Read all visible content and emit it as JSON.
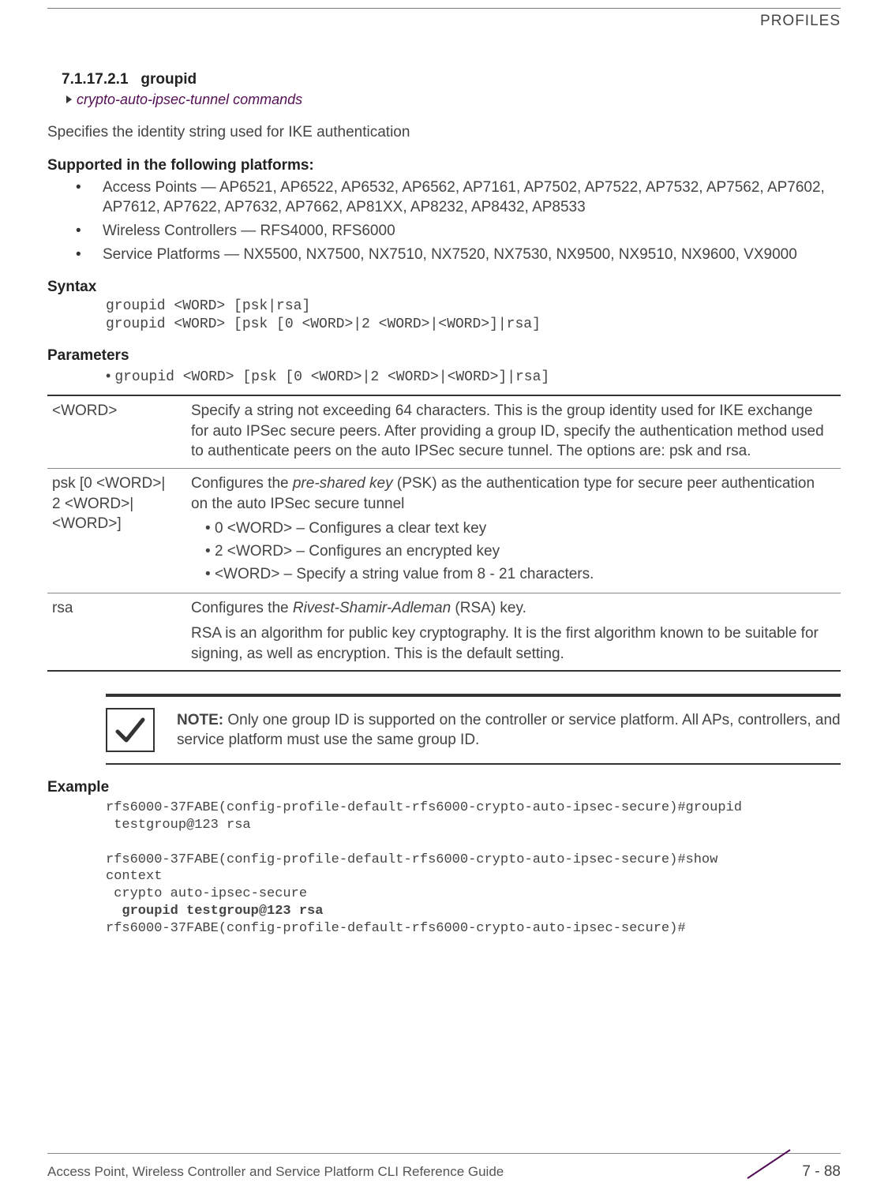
{
  "header": {
    "category": "PROFILES"
  },
  "section": {
    "number": "7.1.17.2.1",
    "title": "groupid",
    "breadcrumb": "crypto-auto-ipsec-tunnel commands",
    "description": "Specifies the identity string used for IKE authentication"
  },
  "platforms": {
    "heading": "Supported in the following platforms:",
    "items": [
      "Access Points — AP6521, AP6522, AP6532, AP6562, AP7161, AP7502, AP7522, AP7532, AP7562, AP7602, AP7612, AP7622, AP7632, AP7662, AP81XX, AP8232, AP8432, AP8533",
      "Wireless Controllers — RFS4000, RFS6000",
      "Service Platforms — NX5500, NX7500, NX7510, NX7520, NX7530, NX9500, NX9510, NX9600, VX9000"
    ]
  },
  "syntax": {
    "heading": "Syntax",
    "lines": "groupid <WORD> [psk|rsa]\ngroupid <WORD> [psk [0 <WORD>|2 <WORD>|<WORD>]|rsa]"
  },
  "parameters": {
    "heading": "Parameters",
    "cmdline": "groupid <WORD> [psk [0 <WORD>|2 <WORD>|<WORD>]|rsa]",
    "rows": [
      {
        "name": "<WORD>",
        "desc": "Specify a string not exceeding 64 characters. This is the group identity used for IKE exchange for auto IPSec secure peers. After providing a group ID, specify the authentication method used to authenticate peers on the auto IPSec secure tunnel. The options are: psk and rsa."
      },
      {
        "name": "psk [0 <WORD>|\n2 <WORD>|\n<WORD>]",
        "desc_intro": "Configures the ",
        "desc_em": "pre-shared key",
        "desc_after": " (PSK) as the authentication type for secure peer authentication on the auto IPSec secure tunnel",
        "bullets": [
          "0 <WORD> – Configures a clear text key",
          "2 <WORD> – Configures an encrypted key",
          "<WORD> – Specify a string value from 8 - 21 characters."
        ]
      },
      {
        "name": "rsa",
        "desc_intro": "Configures the ",
        "desc_em": "Rivest-Shamir-Adleman",
        "desc_after": " (RSA) key.",
        "desc2": "RSA is an algorithm for public key cryptography. It is the first algorithm known to be suitable for signing, as well as encryption. This is the default setting."
      }
    ]
  },
  "note": {
    "label": "NOTE:",
    "text": " Only one group ID is supported on the controller or service platform. All APs, controllers, and service platform must use the same group ID."
  },
  "example": {
    "heading": "Example",
    "pre1": "rfs6000-37FABE(config-profile-default-rfs6000-crypto-auto-ipsec-secure)#groupid\n testgroup@123 rsa\n\nrfs6000-37FABE(config-profile-default-rfs6000-crypto-auto-ipsec-secure)#show \ncontext\n crypto auto-ipsec-secure",
    "bold": "  groupid testgroup@123 rsa",
    "pre2": "rfs6000-37FABE(config-profile-default-rfs6000-crypto-auto-ipsec-secure)#"
  },
  "footer": {
    "doc": "Access Point, Wireless Controller and Service Platform CLI Reference Guide",
    "page": "7 - 88"
  }
}
